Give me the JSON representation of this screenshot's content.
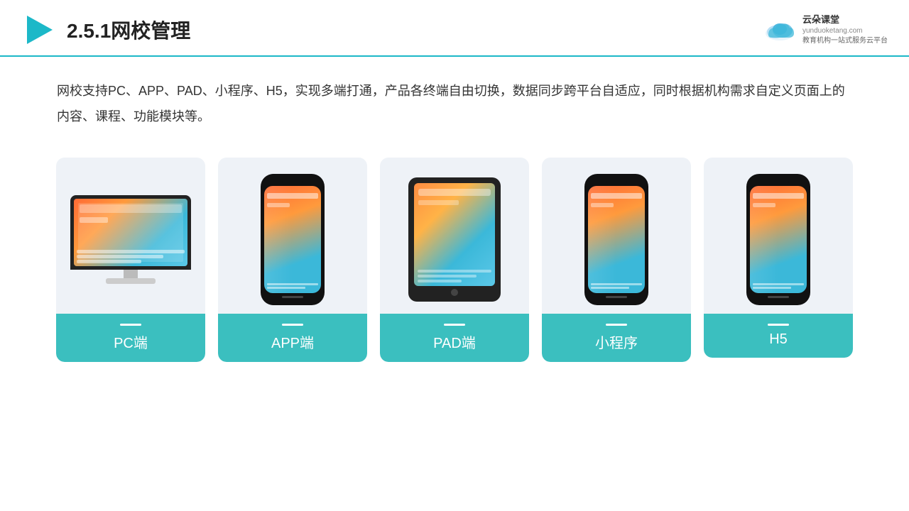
{
  "header": {
    "title": "2.5.1网校管理",
    "logo_name": "云朵课堂",
    "logo_url": "yunduoketang.com",
    "logo_tagline": "教育机构一站式服务云平台"
  },
  "description": {
    "text": "网校支持PC、APP、PAD、小程序、H5，实现多端打通，产品各终端自由切换，数据同步跨平台自适应，同时根据机构需求自定义页面上的内容、课程、功能模块等。"
  },
  "cards": [
    {
      "id": "pc",
      "label": "PC端",
      "type": "pc"
    },
    {
      "id": "app",
      "label": "APP端",
      "type": "phone"
    },
    {
      "id": "pad",
      "label": "PAD端",
      "type": "tablet"
    },
    {
      "id": "miniprogram",
      "label": "小程序",
      "type": "phone"
    },
    {
      "id": "h5",
      "label": "H5",
      "type": "phone"
    }
  ],
  "colors": {
    "accent": "#3bbfbf",
    "header_border": "#1cb8c8",
    "text_dark": "#222222",
    "text_body": "#333333",
    "card_bg": "#eef2f7"
  }
}
